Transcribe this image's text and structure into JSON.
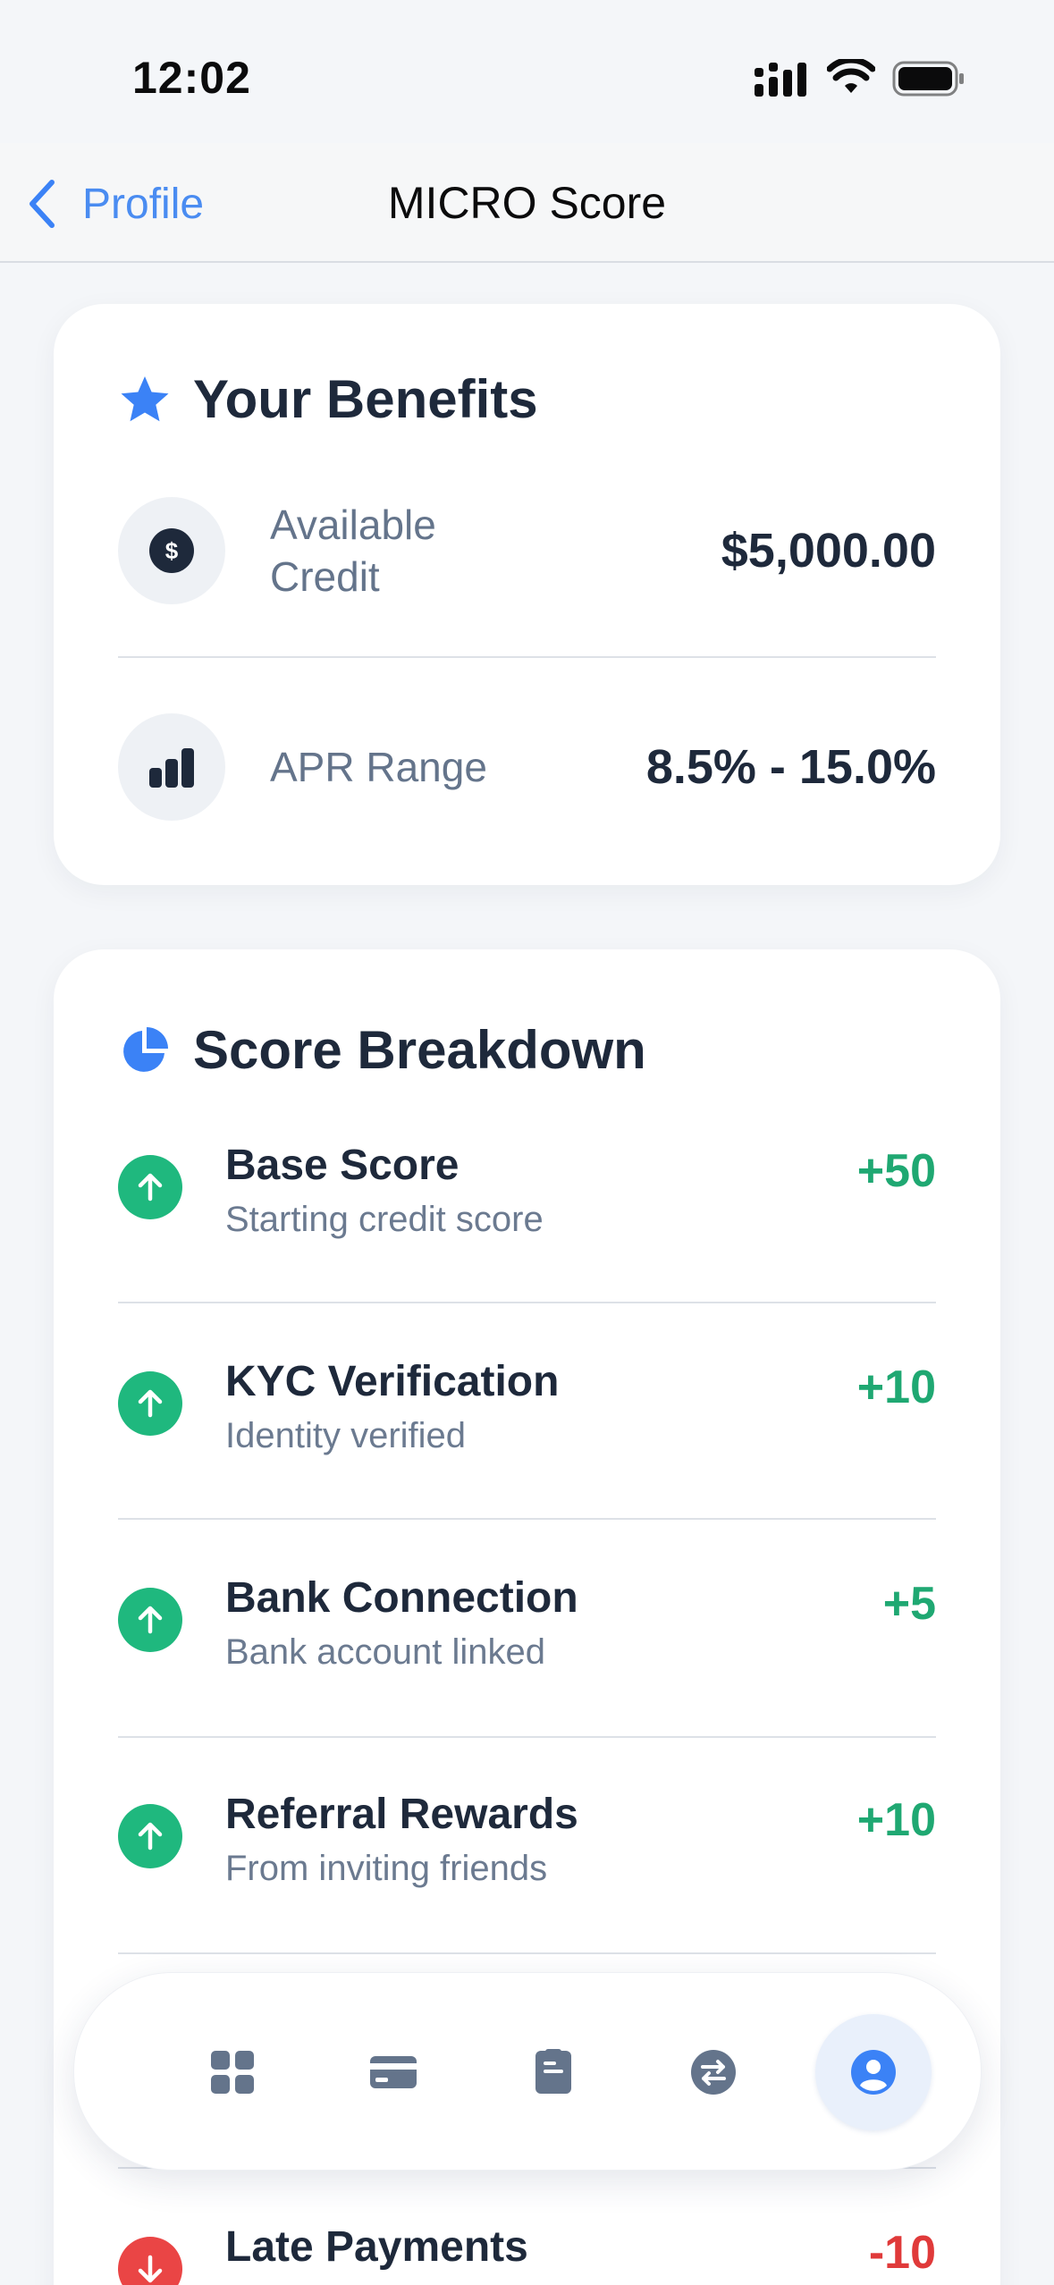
{
  "status_bar": {
    "time": "12:02"
  },
  "nav": {
    "back_label": "Profile",
    "title": "MICRO Score"
  },
  "benefits": {
    "title": "Your Benefits",
    "items": [
      {
        "label": "Available Credit",
        "value": "$5,000.00",
        "icon": "dollar-icon"
      },
      {
        "label": "APR Range",
        "value": "8.5% - 15.0%",
        "icon": "bar-chart-icon"
      }
    ]
  },
  "breakdown": {
    "title": "Score Breakdown",
    "items": [
      {
        "name": "Base Score",
        "desc": "Starting credit score",
        "points": "+50",
        "direction": "up"
      },
      {
        "name": "KYC Verification",
        "desc": "Identity verified",
        "points": "+10",
        "direction": "up"
      },
      {
        "name": "Bank Connection",
        "desc": "Bank account linked",
        "points": "+5",
        "direction": "up"
      },
      {
        "name": "Referral Rewards",
        "desc": "From inviting friends",
        "points": "+10",
        "direction": "up"
      },
      {
        "name": "Late Payments",
        "desc": "",
        "points": "-10",
        "direction": "down"
      }
    ]
  },
  "tabbar": {
    "tabs": [
      {
        "icon": "dashboard-icon",
        "active": false
      },
      {
        "icon": "card-icon",
        "active": false
      },
      {
        "icon": "clipboard-icon",
        "active": false
      },
      {
        "icon": "transfer-icon",
        "active": false
      },
      {
        "icon": "profile-icon",
        "active": true
      }
    ]
  },
  "colors": {
    "accent": "#3b82f6",
    "positive": "#1fa872",
    "negative": "#e03a3a"
  }
}
